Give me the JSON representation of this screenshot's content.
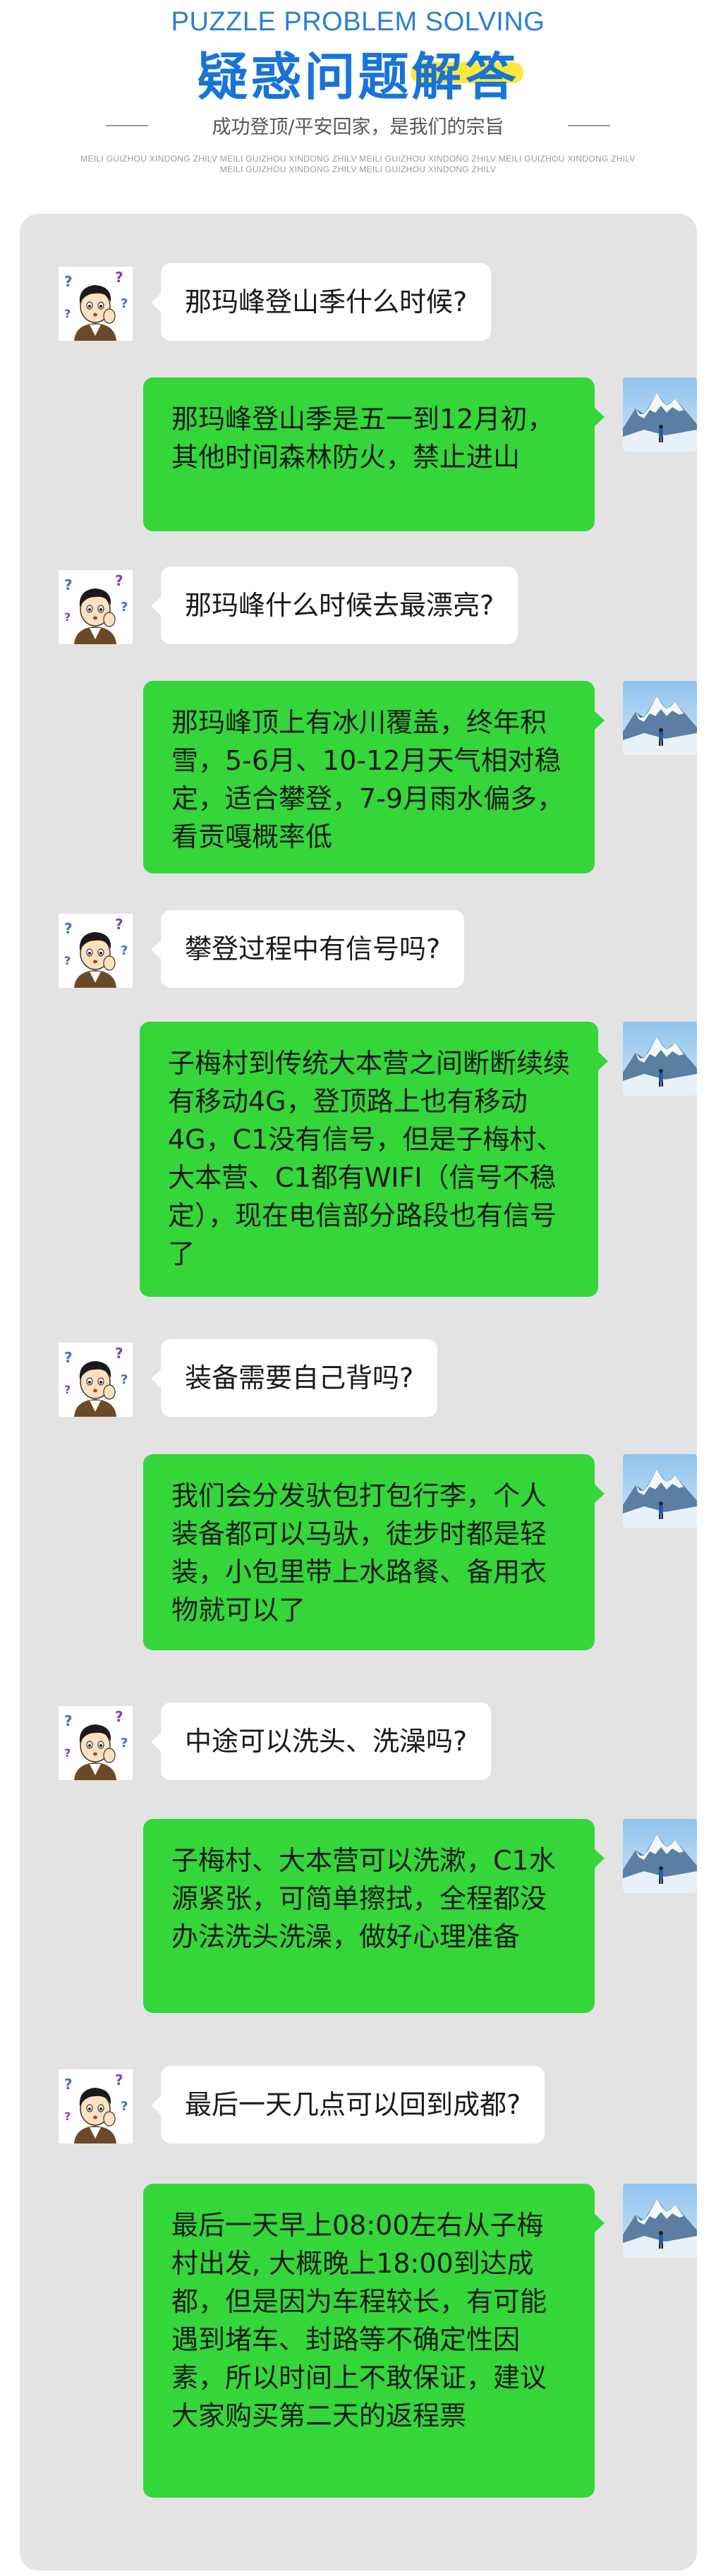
{
  "header": {
    "title_en": "PUZZLE PROBLEM SOLVING",
    "title_cn_main": "疑惑问题",
    "title_cn_highlight": "解答",
    "slogan": "成功登顶/平安回家，是我们的宗旨",
    "small_line_1": "MEILI GUIZHOU XINDONG ZHILV  MEILI GUIZHOU XINDONG ZHILV  MEILI GUIZHOU XINDONG ZHILV  MEILI GUIZHOU XINDONG ZHILV",
    "small_line_2": "MEILI GUIZHOU XINDONG ZHILV  MEILI GUIZHOU XINDONG ZHILV"
  },
  "colors": {
    "accent_blue": "#1874d6",
    "highlight_yellow": "#ffe73d",
    "answer_bubble": "#34d63a",
    "question_bubble": "#ffffff",
    "panel_bg": "#e3e3e3"
  },
  "icons": {
    "question_avatar": "confused-boy-avatar-icon",
    "answer_avatar": "snow-mountain-avatar-icon"
  },
  "qa": [
    {
      "q": "那玛峰登山季什么时候?",
      "a": "那玛峰登山季是五一到12月初，其他时间森林防火，禁止进山"
    },
    {
      "q": "那玛峰什么时候去最漂亮?",
      "a": "那玛峰顶上有冰川覆盖，终年积雪，5-6月、10-12月天气相对稳定，适合攀登，7-9月雨水偏多，看贡嘎概率低"
    },
    {
      "q": "攀登过程中有信号吗?",
      "a": "子梅村到传统大本营之间断断续续有移动4G，登顶路上也有移动4G，C1没有信号，但是子梅村、大本营、C1都有WIFI（信号不稳定），现在电信部分路段也有信号了"
    },
    {
      "q": "装备需要自己背吗?",
      "a": "我们会分发驮包打包行李，个人装备都可以马驮，徒步时都是轻装，小包里带上水路餐、备用衣物就可以了"
    },
    {
      "q": "中途可以洗头、洗澡吗?",
      "a": "子梅村、大本营可以洗漱，C1水源紧张，可简单擦拭，全程都没办法洗头洗澡，做好心理准备"
    },
    {
      "q": "最后一天几点可以回到成都?",
      "a": "最后一天早上08:00左右从子梅村出发, 大概晚上18:00到达成都，但是因为车程较长，有可能遇到堵车、封路等不确定性因素，所以时间上不敢保证，建议大家购买第二天的返程票"
    }
  ]
}
